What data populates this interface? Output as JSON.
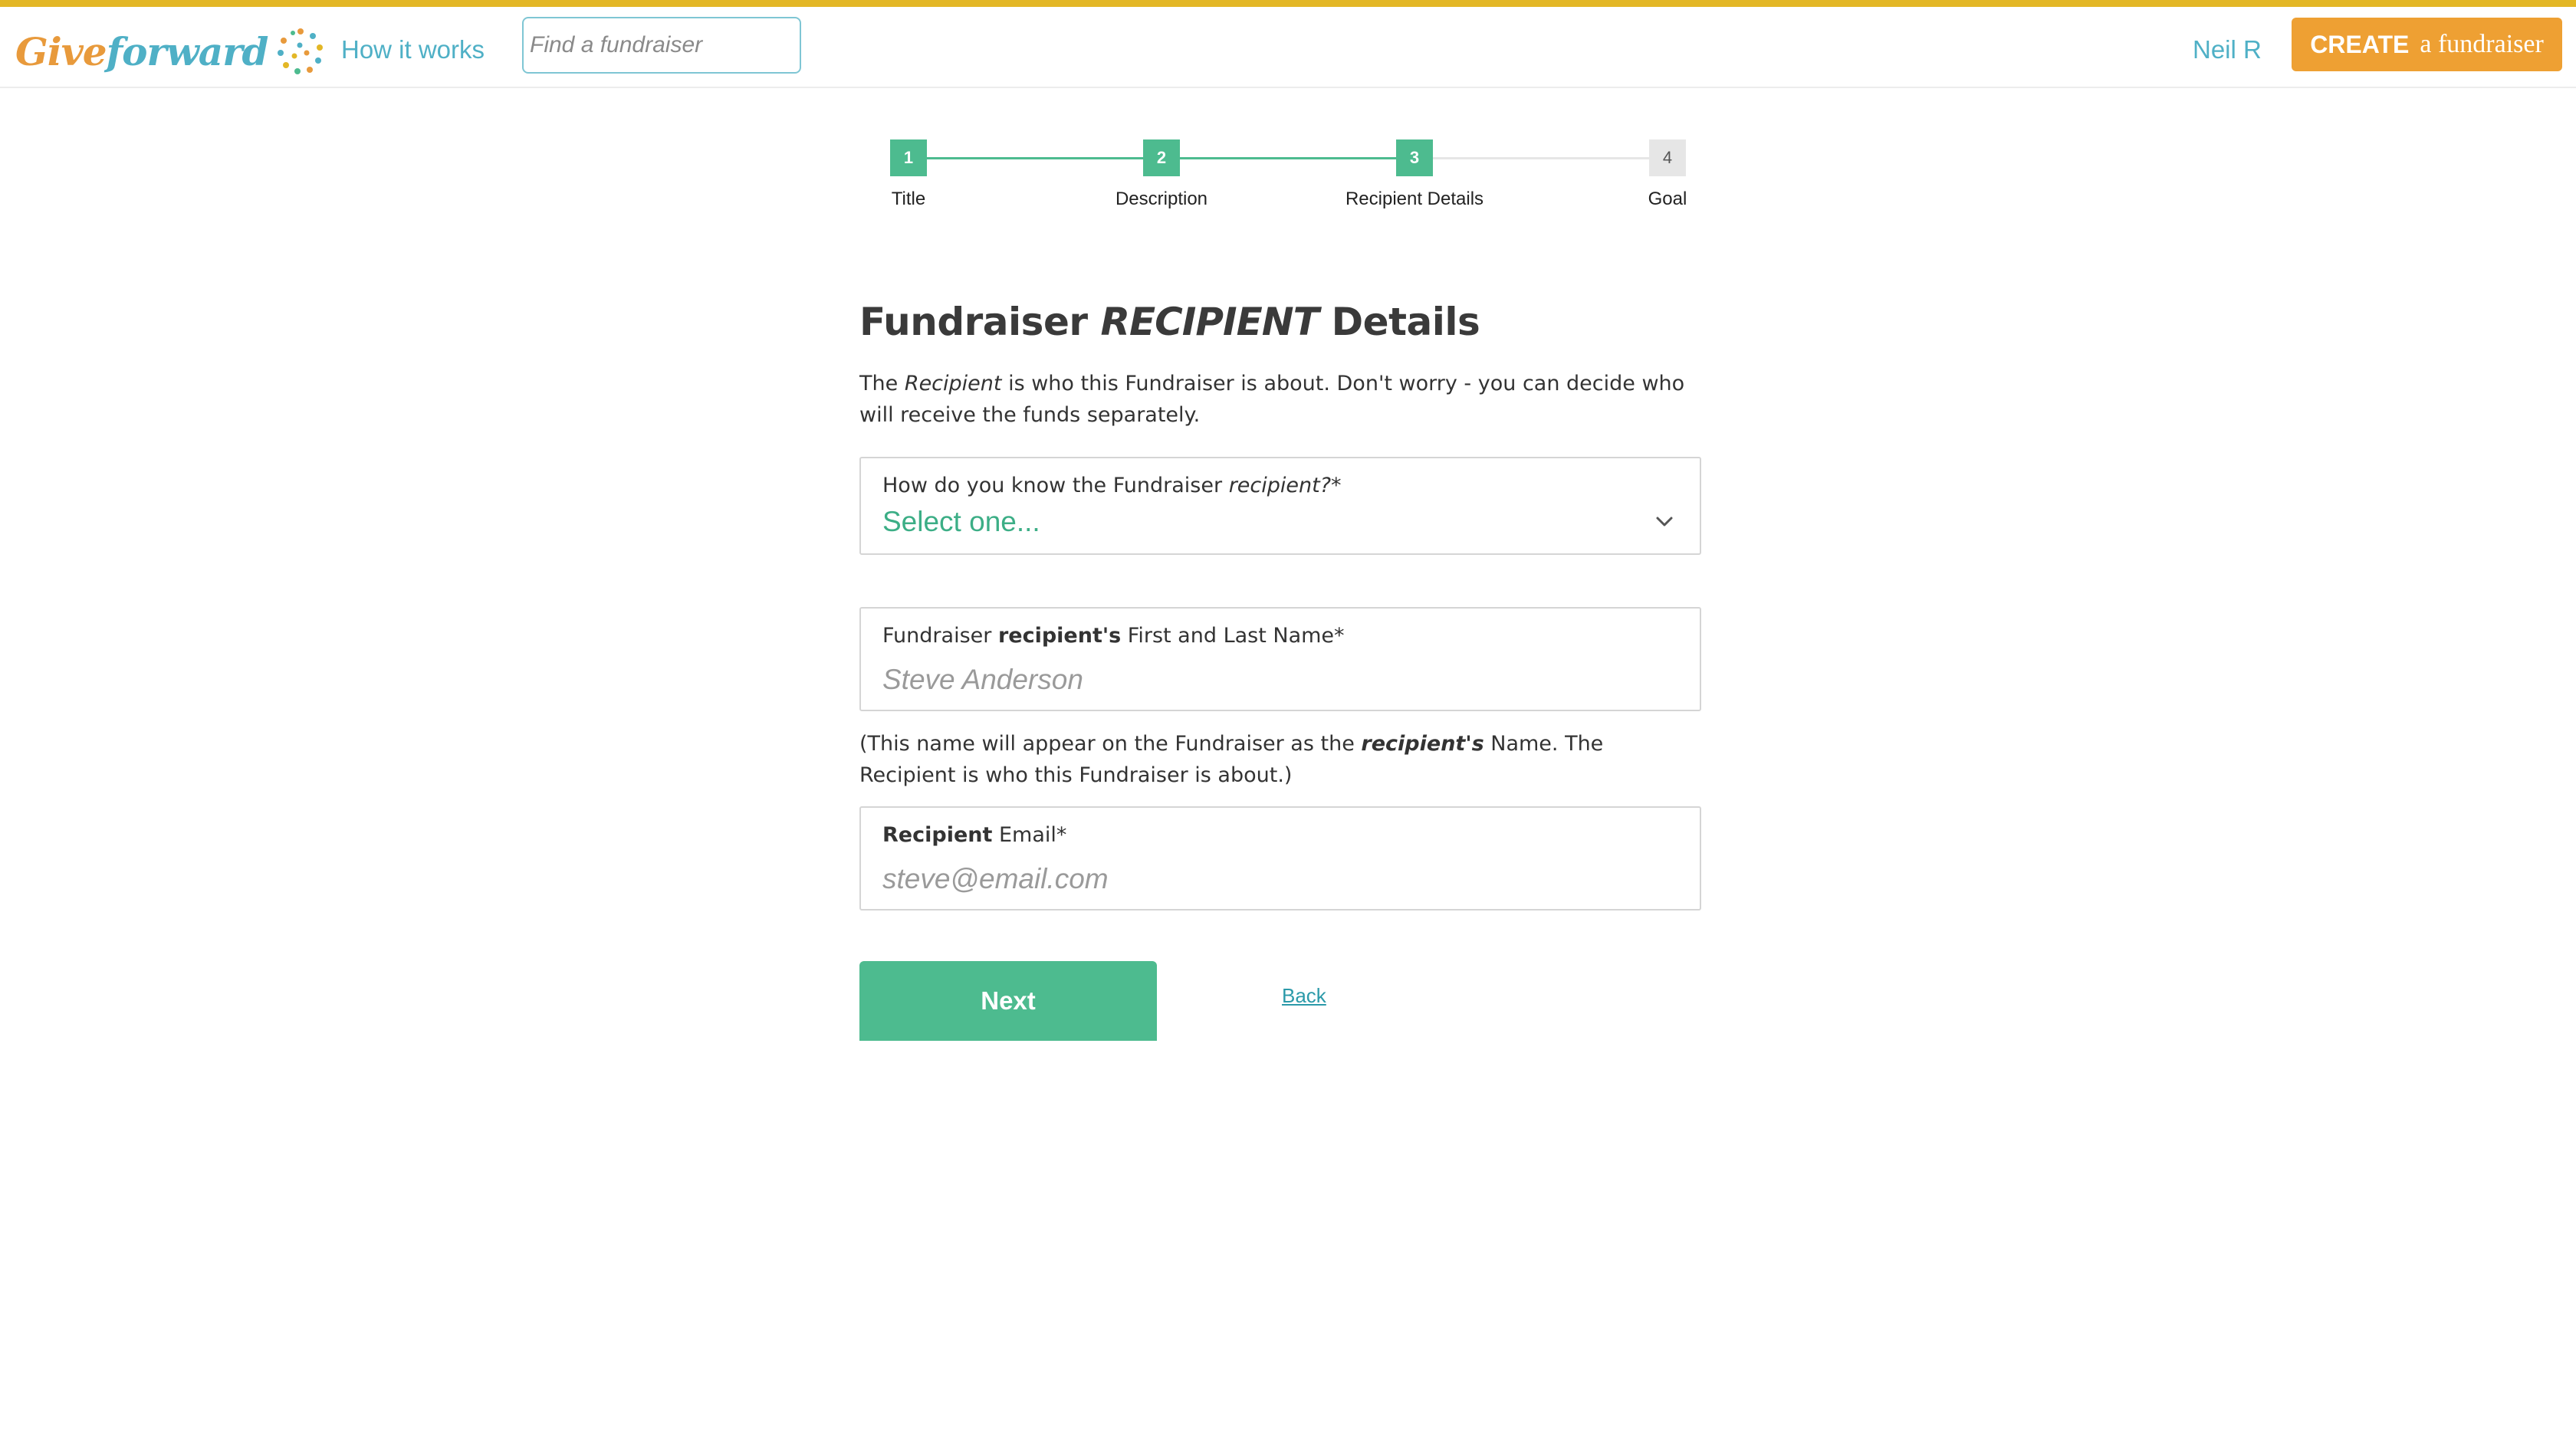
{
  "header": {
    "logo_give": "Give",
    "logo_forward": "forward",
    "nav_how_it_works": "How it works",
    "search_placeholder": "Find a fundraiser",
    "user_name": "Neil R",
    "create_strong": "CREATE",
    "create_rest": "a fundraiser",
    "accent_color": "#e3b726",
    "create_color": "#eea033",
    "link_color": "#4fb0c6"
  },
  "stepper": {
    "steps": [
      {
        "number": "1",
        "label": "Title",
        "state": "complete"
      },
      {
        "number": "2",
        "label": "Description",
        "state": "complete"
      },
      {
        "number": "3",
        "label": "Recipient Details",
        "state": "current"
      },
      {
        "number": "4",
        "label": "Goal",
        "state": "incomplete"
      }
    ],
    "active_color": "#4dbb8f"
  },
  "form": {
    "title_prefix": "Fundraiser",
    "title_emphasis": "RECIPIENT",
    "title_suffix": "Details",
    "intro_part1": "The",
    "intro_em": "Recipient",
    "intro_part2": "is who this Fundraiser is about. Don't worry - you can decide who will receive the funds separately.",
    "relationship": {
      "label_text": "How do you know the Fundraiser",
      "label_em": "recipient?*",
      "value": "Select one..."
    },
    "recipient_name": {
      "label_text": "Fundraiser",
      "label_strong": "recipient's",
      "label_rest": "First and Last Name*",
      "placeholder": "Steve Anderson"
    },
    "name_note_part1": "(This name will appear on the Fundraiser as the",
    "name_note_em": "recipient's",
    "name_note_part2": "Name. The Recipient is who this Fundraiser is about.)",
    "recipient_email": {
      "label_strong": "Recipient",
      "label_rest": "Email*",
      "placeholder": "steve@email.com"
    },
    "next_label": "Next",
    "back_label": "Back"
  }
}
